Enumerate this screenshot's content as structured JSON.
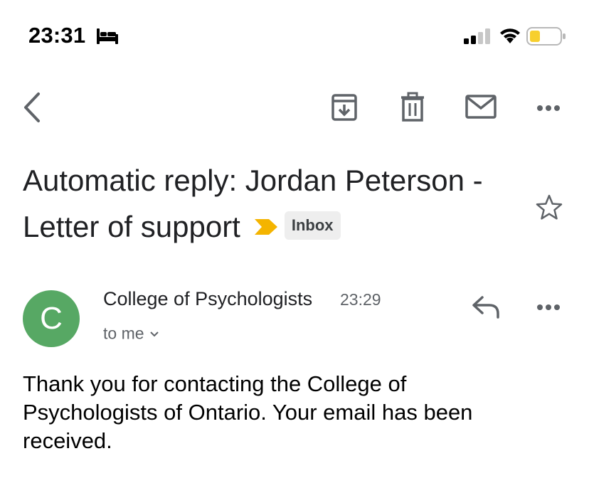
{
  "status_bar": {
    "time": "23:31",
    "icons": [
      "sleep-icon",
      "cellular-signal-icon",
      "wifi-icon",
      "battery-low-icon"
    ]
  },
  "toolbar": {
    "icons": [
      "back-chevron-icon",
      "archive-icon",
      "trash-icon",
      "mail-icon",
      "more-horizontal-icon"
    ]
  },
  "subject": {
    "text": "Automatic reply: Jordan Peterson - Letter of support",
    "label": "Inbox",
    "importance_color": "#f4b400"
  },
  "message": {
    "avatar_letter": "C",
    "avatar_color": "#57a864",
    "sender": "College of Psychologists",
    "time": "23:29",
    "recipient": "to me",
    "body": "Thank you for contacting the College of Psychologists of Ontario. Your email has been received."
  }
}
